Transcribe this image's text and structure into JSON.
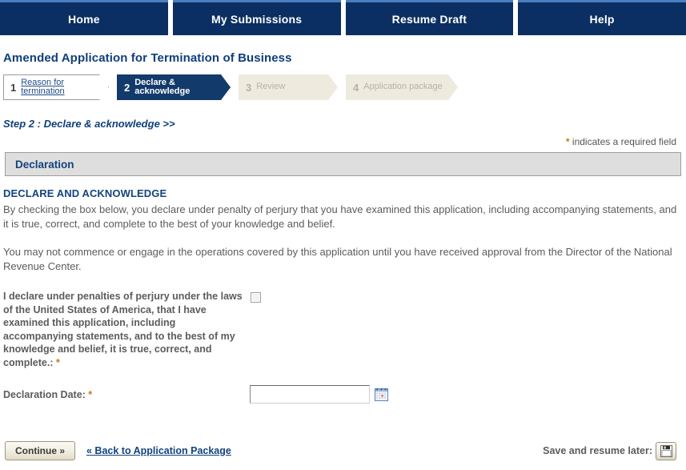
{
  "nav": {
    "tabs": [
      {
        "label": "Home",
        "name": "home"
      },
      {
        "label": "My Submissions",
        "name": "my-submissions"
      },
      {
        "label": "Resume Draft",
        "name": "resume-draft"
      },
      {
        "label": "Help",
        "name": "help"
      }
    ]
  },
  "page": {
    "title": "Amended Application for Termination of Business",
    "step_subtitle": "Step 2 : Declare & acknowledge >>",
    "required_note_star": "*",
    "required_note": " indicates a required field"
  },
  "steps": [
    {
      "num": "1",
      "label": "Reason for termination",
      "state": "done"
    },
    {
      "num": "2",
      "label": "Declare & acknowledge",
      "state": "active"
    },
    {
      "num": "3",
      "label": "Review",
      "state": "todo"
    },
    {
      "num": "4",
      "label": "Application package",
      "state": "todo"
    }
  ],
  "section": {
    "header": "Declaration",
    "subhead": "DECLARE AND ACKNOWLEDGE",
    "paragraph_1": "By checking the box below, you declare under penalty of perjury that you have examined this application, including accompanying statements, and it is true, correct, and complete to the best of your knowledge and belief.",
    "paragraph_2": "You may not commence or engage in the operations covered by this application until you have received approval from the Director of the National Revenue Center."
  },
  "form": {
    "declare_label": "I declare under penalties of perjury under the laws of the United States of America, that I have examined this application, including accompanying statements, and to the best of my knowledge and belief, it is true, correct, and complete.: ",
    "declare_required_star": "*",
    "declare_checked": false,
    "date_label": "Declaration Date: ",
    "date_required_star": "*",
    "date_value": "",
    "date_placeholder": "",
    "calendar_icon": "calendar-icon"
  },
  "footer": {
    "continue_label": "Continue »",
    "back_link": "« Back to Application Package",
    "save_label": "Save and resume later:",
    "save_icon": "floppy-disk-save-icon"
  },
  "colors": {
    "nav_blue": "#0b2f62",
    "nav_top_border": "#4a7fc1",
    "title_blue": "#0f3f7a",
    "active_step": "#123a6b",
    "todo_step": "#efeade",
    "section_bar": "#dedede",
    "required_star": "#c87512",
    "body_text": "#5c5c5c"
  }
}
